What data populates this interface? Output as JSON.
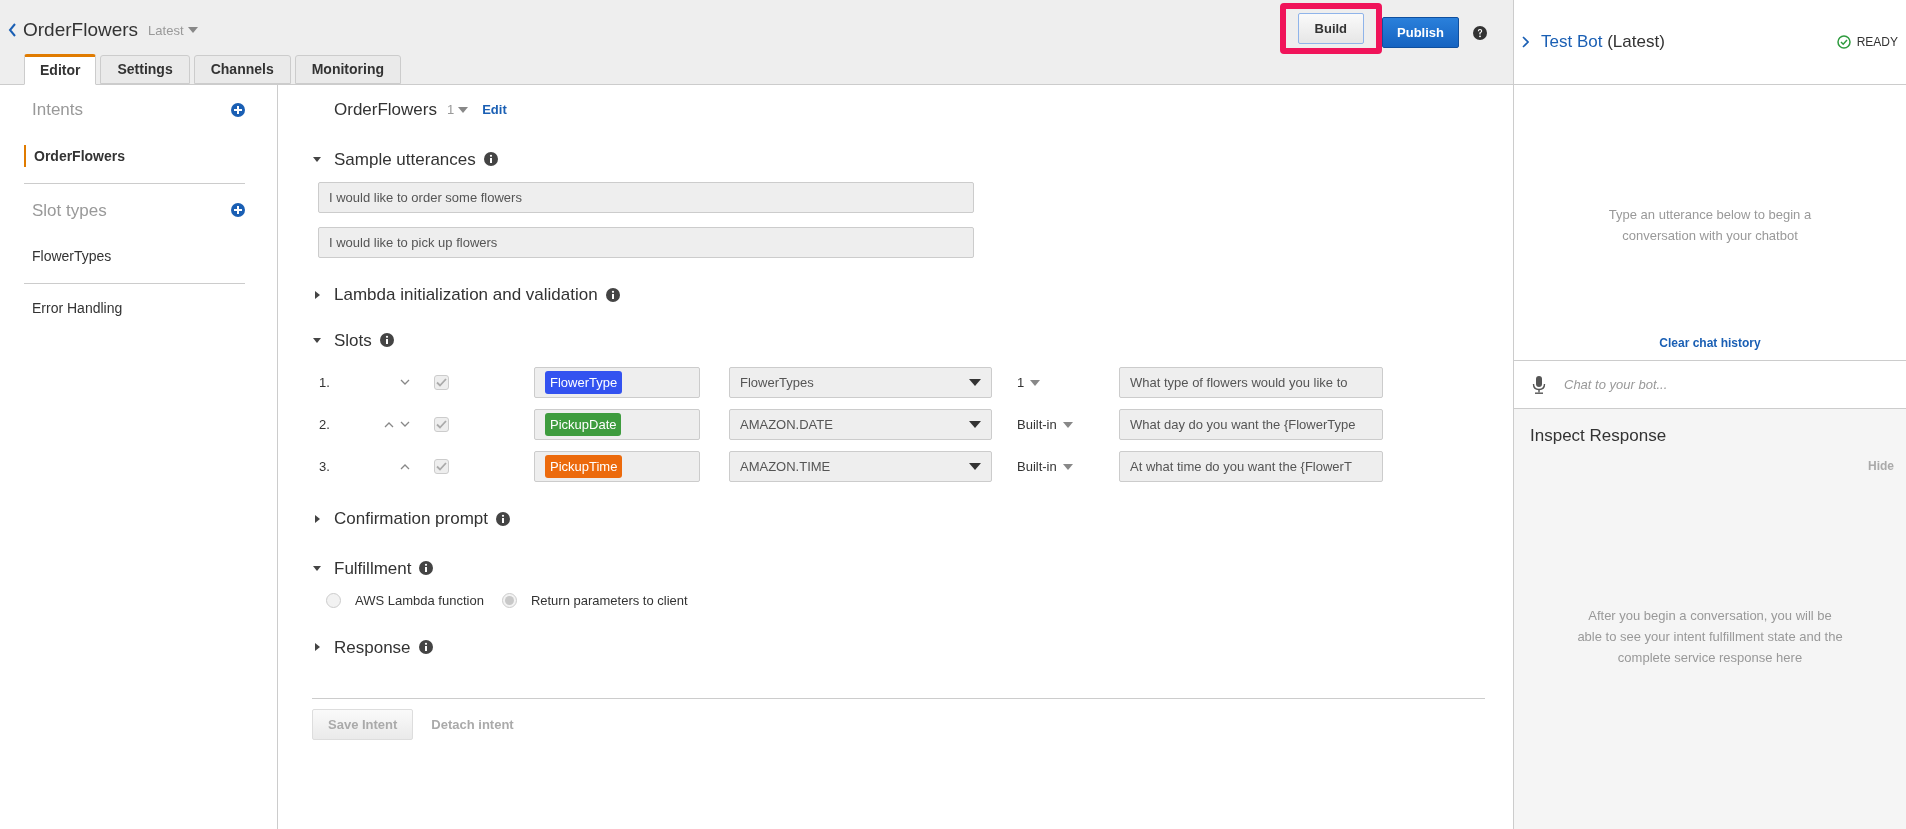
{
  "header": {
    "bot_name": "OrderFlowers",
    "version": "Latest",
    "build_button": "Build",
    "publish_button": "Publish"
  },
  "tabs": [
    {
      "label": "Editor",
      "selected": true
    },
    {
      "label": "Settings",
      "selected": false
    },
    {
      "label": "Channels",
      "selected": false
    },
    {
      "label": "Monitoring",
      "selected": false
    }
  ],
  "sidebar": {
    "groups": [
      {
        "heading": "Intents",
        "items": [
          {
            "label": "OrderFlowers",
            "selected": true
          }
        ]
      },
      {
        "heading": "Slot types",
        "items": [
          {
            "label": "FlowerTypes",
            "selected": false
          }
        ]
      }
    ],
    "links": [
      "Error Handling"
    ]
  },
  "intent": {
    "name": "OrderFlowers",
    "version": "1",
    "edit_link": "Edit"
  },
  "sections": [
    {
      "kind": "utterances",
      "title": "Sample utterances",
      "expanded": true,
      "utterances": [
        "I would like to order some flowers",
        "I would like to pick up flowers"
      ]
    },
    {
      "kind": "plain",
      "title": "Lambda initialization and validation",
      "expanded": false
    },
    {
      "kind": "slots",
      "title": "Slots",
      "expanded": true,
      "slots": [
        {
          "number": "1.",
          "can_move_up": false,
          "can_move_down": true,
          "required": true,
          "name": "FlowerType",
          "color": "#3352f0",
          "slot_type": "FlowerTypes",
          "version": "1",
          "prompt": "What type of flowers would you like to"
        },
        {
          "number": "2.",
          "can_move_up": true,
          "can_move_down": true,
          "required": true,
          "name": "PickupDate",
          "color": "#3e9c3e",
          "slot_type": "AMAZON.DATE",
          "version": "Built-in",
          "prompt": "What day do you want the {FlowerType"
        },
        {
          "number": "3.",
          "can_move_up": true,
          "can_move_down": false,
          "required": true,
          "name": "PickupTime",
          "color": "#ec6a0c",
          "slot_type": "AMAZON.TIME",
          "version": "Built-in",
          "prompt": "At what time do you want the {FlowerT"
        }
      ]
    },
    {
      "kind": "plain",
      "title": "Confirmation prompt",
      "expanded": false
    },
    {
      "kind": "fulfillment",
      "title": "Fulfillment",
      "expanded": true,
      "options": [
        {
          "label": "AWS Lambda function",
          "selected": false
        },
        {
          "label": "Return parameters to client",
          "selected": true
        }
      ]
    },
    {
      "kind": "plain",
      "title": "Response",
      "expanded": false
    }
  ],
  "footer_buttons": {
    "save": "Save Intent",
    "detach": "Detach intent"
  },
  "test_bot": {
    "title": "Test Bot",
    "version": "(Latest)",
    "status": "READY",
    "empty_message": "Type an utterance below to begin a conversation with your chatbot",
    "clear_link": "Clear chat history",
    "chat_placeholder": "Chat to your bot...",
    "inspect_title": "Inspect Response",
    "hide_link": "Hide",
    "inspect_message": "After you begin a conversation, you will be able to see your intent fulfillment state and the complete service response here"
  }
}
